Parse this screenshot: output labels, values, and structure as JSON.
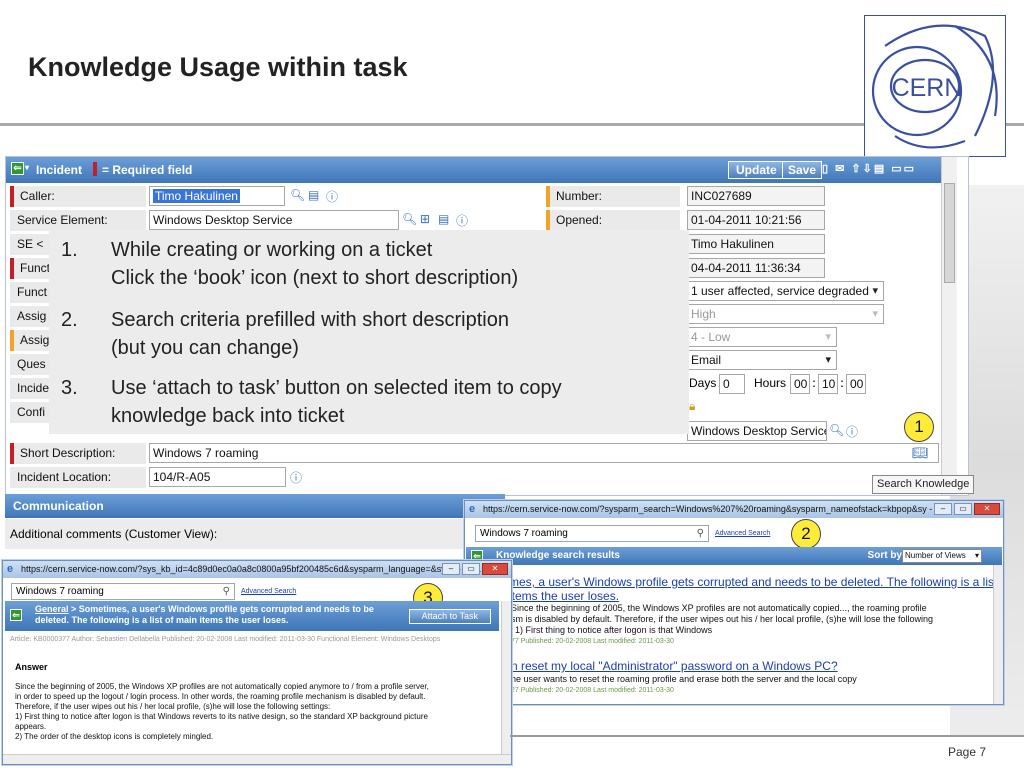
{
  "slide": {
    "title": "Knowledge Usage within task",
    "page": "Page 7",
    "logo_text": "CERN"
  },
  "form": {
    "header_title": "Incident",
    "required_text": "= Required field",
    "update_label": "Update",
    "save_label": "Save",
    "header_tools": "▯ ✉ ⇧⇩▤ ▭▭",
    "left_fields": [
      {
        "label": "Caller:",
        "value": "Timo Hakulinen"
      },
      {
        "label": "Service Element:",
        "value": "Windows Desktop Service"
      },
      {
        "label": "SE <"
      },
      {
        "label": "Funct"
      },
      {
        "label": "Funct"
      },
      {
        "label": "Assig"
      },
      {
        "label": "Assig"
      },
      {
        "label": "Ques"
      },
      {
        "label": "Incide"
      },
      {
        "label": "Confi"
      },
      {
        "label": "Short Description:",
        "value": "Windows 7 roaming"
      },
      {
        "label": "Incident Location:",
        "value": "104/R-A05"
      }
    ],
    "right_fields": [
      {
        "label": "Number:",
        "value": "INC027689"
      },
      {
        "label": "Opened:",
        "value": "01-04-2011 10:21:56"
      },
      {
        "value": "Timo Hakulinen"
      },
      {
        "value": "04-04-2011 11:36:34"
      },
      {
        "value": "1 user affected, service degraded"
      },
      {
        "value": "High"
      },
      {
        "value": "4 - Low"
      },
      {
        "value": "Email"
      },
      {
        "value": "Windows Desktop Service"
      }
    ],
    "duration": {
      "days_label": "Days",
      "days": "0",
      "hours_label": "Hours",
      "hh": "00",
      "mm": "10",
      "ss": "00",
      "sep": ":"
    },
    "overlay_steps": [
      {
        "num": "1.",
        "line1": "While creating or working on a ticket",
        "line2": "Click the ‘book’ icon (next to short description)"
      },
      {
        "num": "2.",
        "line1": "Search criteria prefilled with short description",
        "line2": "(but you can change)"
      },
      {
        "num": "3.",
        "line1": "Use ‘attach to task’ button on selected item to copy",
        "line2": "knowledge back into ticket"
      }
    ],
    "tooltip": "Search Knowledge",
    "communication": "Communication",
    "additional_comments": "Additional comments (Customer View):"
  },
  "badges": [
    "1",
    "2",
    "3"
  ],
  "search_window": {
    "title": "https://cern.service-now.com/?sysparm_search=Windows%207%20roaming&sysparm_nameofstack=kbpop&sy - ...",
    "query": "Windows 7 roaming",
    "advanced": "Advanced Search",
    "results_header": "Knowledge search results",
    "sort_label": "Sort by",
    "sort_value": "Number of Views",
    "results": [
      {
        "link1": "mes, a user's Windows profile gets corrupted and needs to be deleted. The following is a list",
        "link2": "items the user loses.",
        "snippet1": "Since the beginning of 2005, the Windows XP profiles are not automatically copied..., the roaming profile",
        "snippet2": "sm is disabled by default. Therefore, if the user wipes out his / her local profile, (s)he will lose the following",
        "snippet3": "1) First thing to notice after logon is that Windows",
        "meta": "77  Published: 20-02-2008  Last modified: 2011-03-30"
      },
      {
        "link1": "n reset my local \"Administrator\" password on a Windows PC?",
        "snippet1": "he user wants to reset the roaming profile and erase both the server and the local copy",
        "meta": "27  Published: 20-02-2008  Last modified: 2011-03-30"
      }
    ]
  },
  "article_window": {
    "title": "https://cern.service-now.com/?sys_kb_id=4c89d0ec0a0a8c0800a95bf200485c6d&sysparm_language=&sysp - Win...",
    "query": "Windows 7 roaming",
    "advanced": "Advanced Search",
    "crumb_link": "General",
    "crumb_text": " > Sometimes, a user's Windows profile gets corrupted and needs to be deleted. The following is a list of main items the user loses.",
    "attach_label": "Attach to Task",
    "meta": "Article: KB0000377 Author: Sebastien Dellabella   Published: 20-02-2008   Last modified: 2011-03-30   Functional Element: Windows Desktops",
    "answer_label": "Answer",
    "body": [
      "Since the beginning of 2005, the Windows XP profiles are not automatically copied anymore to / from a profile server,",
      "in order to speed up the logout / login process. In other words, the roaming profile mechanism is disabled by default.",
      "Therefore, if the user wipes out his / her local profile, (s)he will lose the following settings:",
      "1) First thing to notice after logon is that Windows reverts to its native design, so the standard XP background picture",
      "appears.",
      "2) The order of the desktop icons is completely mingled."
    ]
  },
  "colors": {
    "header_blue": "#3f76b8",
    "mandatory_red": "#c0202a",
    "orange": "#f1a428",
    "badge_yellow": "#ffec3a",
    "link_blue": "#1a3fb0"
  }
}
